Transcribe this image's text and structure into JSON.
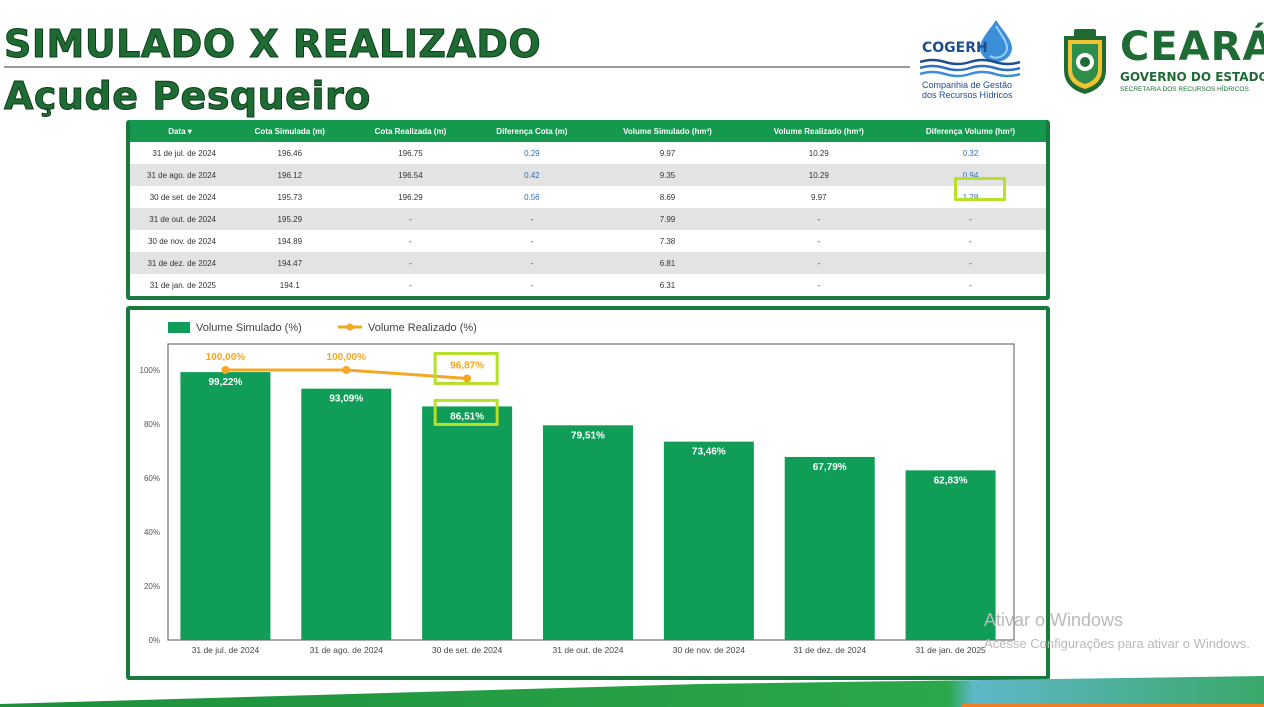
{
  "title_line1": "SIMULADO X REALIZADO",
  "title_line2": "Açude Pesqueiro",
  "logos": {
    "cogerh_name": "COGERH",
    "cogerh_sub_1": "Companhia de Gestão",
    "cogerh_sub_2": "dos Recursos Hídricos",
    "ceara_name": "CEARÁ",
    "ceara_gov": "GOVERNO DO ESTADO",
    "ceara_sec": "SECRETARIA DOS RECURSOS HÍDRICOS"
  },
  "table": {
    "headers": [
      "Data ▾",
      "Cota Simulada (m)",
      "Cota Realizada (m)",
      "Diferença Cota (m)",
      "Volume Simulado (hm³)",
      "Volume Realizado (hm³)",
      "Diferença Volume (hm³)"
    ],
    "rows": [
      [
        "31 de jul. de 2024",
        "196.46",
        "196.75",
        "0.29",
        "9.97",
        "10.29",
        "0.32"
      ],
      [
        "31 de ago. de 2024",
        "196.12",
        "196.54",
        "0.42",
        "9.35",
        "10.29",
        "0.94"
      ],
      [
        "30 de set. de 2024",
        "195.73",
        "196.29",
        "0.56",
        "8.69",
        "9.97",
        "1.28"
      ],
      [
        "31 de out. de 2024",
        "195.29",
        "-",
        "-",
        "7.99",
        "-",
        "-"
      ],
      [
        "30 de nov. de 2024",
        "194.89",
        "-",
        "-",
        "7.38",
        "-",
        "-"
      ],
      [
        "31 de dez. de 2024",
        "194.47",
        "-",
        "-",
        "6.81",
        "-",
        "-"
      ],
      [
        "31 de jan. de 2025",
        "194.1",
        "-",
        "-",
        "6.31",
        "-",
        "-"
      ]
    ]
  },
  "chart_data": {
    "type": "bar",
    "categories": [
      "31 de jul. de 2024",
      "31 de ago. de 2024",
      "30 de set. de 2024",
      "31 de out. de 2024",
      "30 de nov. de 2024",
      "31 de dez. de 2024",
      "31 de jan. de 2025"
    ],
    "series": [
      {
        "name": "Volume Simulado (%)",
        "type": "bar",
        "color": "#0f9d58",
        "values": [
          99.22,
          93.09,
          86.51,
          79.51,
          73.46,
          67.79,
          62.83
        ],
        "labels": [
          "99,22%",
          "93,09%",
          "86,51%",
          "79,51%",
          "73,46%",
          "67,79%",
          "62,83%"
        ]
      },
      {
        "name": "Volume Realizado (%)",
        "type": "line",
        "color": "#f5a623",
        "values": [
          100.0,
          100.0,
          96.87,
          null,
          null,
          null,
          null
        ],
        "labels": [
          "100,00%",
          "100,00%",
          "96,87%",
          null,
          null,
          null,
          null
        ]
      }
    ],
    "yticks": [
      "0%",
      "20%",
      "40%",
      "60%",
      "80%",
      "100%"
    ],
    "ylim": [
      0,
      100
    ],
    "legend_position": "top-left",
    "grid": false,
    "highlights": [
      "96,87%",
      "86,51%"
    ]
  },
  "watermark": {
    "line1": "Ativar o Windows",
    "line2": "Acesse Configurações para ativar o Windows."
  }
}
